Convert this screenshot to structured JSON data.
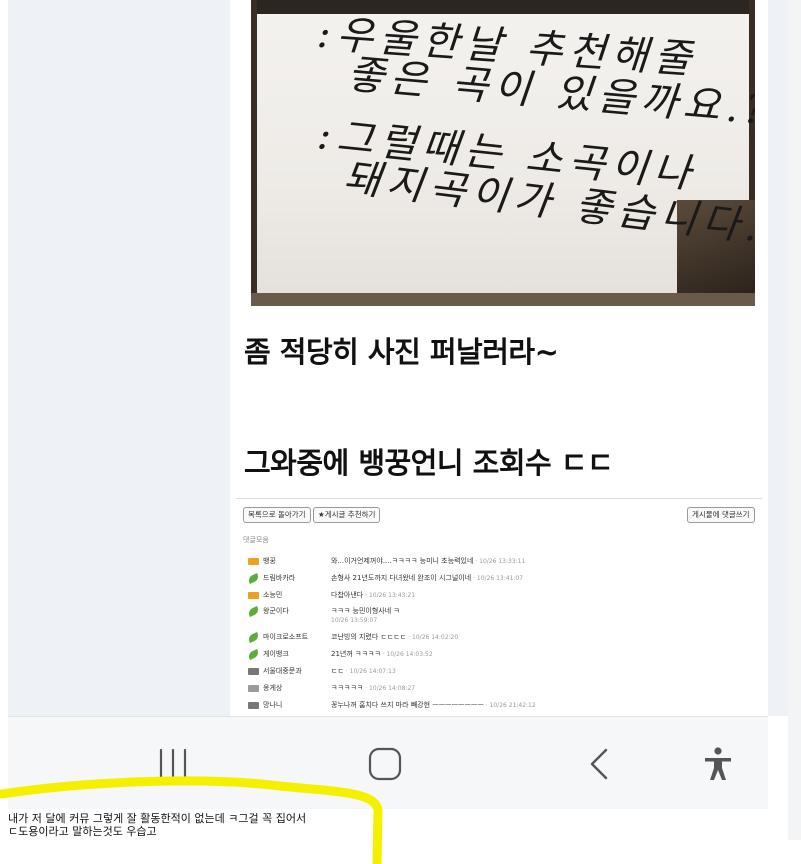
{
  "photo": {
    "lines": [
      ":우울한날 추천해줄",
      "좋은 곡이 있을까요.?",
      ":그럴때는 소곡이나",
      "돼지곡이가 좋습니다."
    ]
  },
  "post": {
    "heading_1": "좀 적당히 사진 퍼날러라~",
    "heading_2": "그와중에 뱅꿍언니 조회수 ㄷㄷ"
  },
  "comments": {
    "back_to_list_label": "목록으로 돌아가기",
    "recommend_label": "★게시글 추천하기",
    "write_comment_label": "게시물에 댓글쓰기",
    "section_title": "댓글모음",
    "rows": [
      {
        "badge": "gold",
        "name": "뱅꿍",
        "text": "와...이거언제꺼야....ㅋㅋㅋㅋ 능미니 초능력있네",
        "time": "10/26 13:33:11"
      },
      {
        "badge": "leaf",
        "name": "드림바카라",
        "text": "손형사 21년도까지 다녀왔네 완조이 시그널이네",
        "time": "10/26 13:41:07"
      },
      {
        "badge": "gold",
        "name": "소능민",
        "text": "다찹아낸다",
        "time": "10/26 13:43:21"
      },
      {
        "badge": "leaf",
        "name": "왕군이다",
        "text": "ㅋㅋㅋ 능민이형사네 ㅋ",
        "time": "10/26 13:59:07"
      },
      {
        "badge": "leaf",
        "name": "마이크로소프트",
        "text": "코난빙의 지렸다 ㄷㄷㄷㄷ",
        "time": "10/26 14:02:20"
      },
      {
        "badge": "leaf",
        "name": "게이뱅크",
        "text": "21년꺼 ㅋㅋㅋㅋ",
        "time": "10/26 14:03:52"
      },
      {
        "badge": "gray",
        "name": "서울대중문과",
        "text": "ㄷㄷ",
        "time": "10/26 14:07:13"
      },
      {
        "badge": "lgray",
        "name": "옹게상",
        "text": "ㅋㅋㅋㅋㅋ",
        "time": "10/26 14:08:27"
      },
      {
        "badge": "gray",
        "name": "망나니",
        "text": "꽁누나꺼 훔치다 쓰지 마라 빼강현 ㅡㅡㅡㅡㅡㅡㅡㅡ",
        "time": "10/26 21:42:12"
      }
    ]
  },
  "navbar": {
    "icons": [
      "recent-apps-icon",
      "home-icon",
      "back-icon",
      "accessibility-icon"
    ],
    "color": "#555555"
  },
  "overlay": {
    "highlight_color": "#f5f000",
    "caption_line_1": "내가 저 달에 커뮤 그렇게 잘 활동한적이 없는데 ㅋ그걸 꼭 집어서",
    "caption_line_2": "ㄷ도용이라고 말하는것도 우습고"
  }
}
